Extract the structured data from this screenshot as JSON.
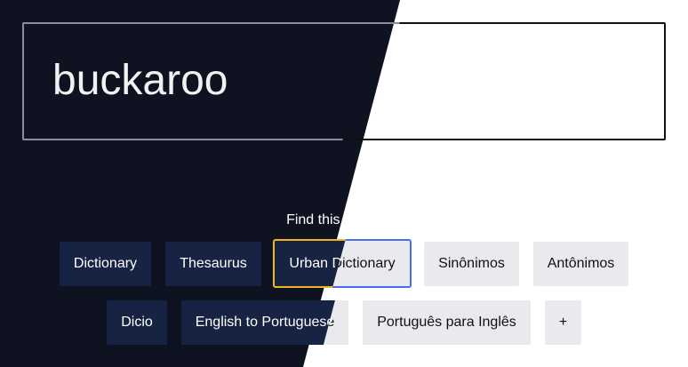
{
  "search": {
    "word": "buckaroo"
  },
  "find_label": "Find this word in...",
  "buttons": [
    {
      "label": "Dictionary"
    },
    {
      "label": "Thesaurus"
    },
    {
      "label": "Urban Dictionary"
    },
    {
      "label": "Sinônimos"
    },
    {
      "label": "Antônimos"
    },
    {
      "label": "Dicio"
    },
    {
      "label": "English to Portuguese"
    },
    {
      "label": "Português para Inglês"
    },
    {
      "label": "+"
    }
  ],
  "colors": {
    "dark_background": "#0f1220",
    "light_background": "#ffffff",
    "dark_button": "#172342",
    "light_button": "#e9e9ee",
    "focus_outline_dark": "#f2b51c",
    "focus_outline_light": "#4a6cf7"
  }
}
